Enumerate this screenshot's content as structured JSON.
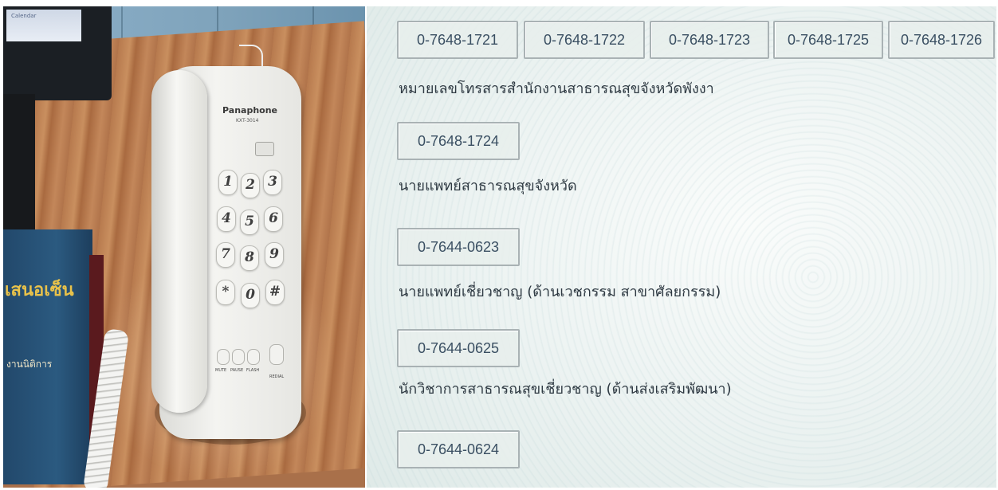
{
  "photo": {
    "brand": "Panaphone",
    "model": "KXT-3014",
    "keys": [
      "1",
      "2",
      "3",
      "4",
      "5",
      "6",
      "7",
      "8",
      "9",
      "*",
      "0",
      "#"
    ],
    "function_keys": [
      "MUTE",
      "PAUSE",
      "FLASH",
      "REDIAL"
    ],
    "book_title": "เสนอเซ็น",
    "book_subtitle": "งานนิติการ",
    "screen_text": "Calendar"
  },
  "directory": {
    "top_numbers": [
      "0-7648-1721",
      "0-7648-1722",
      "0-7648-1723",
      "0-7648-1725",
      "0-7648-1726"
    ],
    "entries": [
      {
        "label": "หมายเลขโทรสารสำนักงานสาธารณสุขจังหวัดพังงา",
        "number": "0-7648-1724"
      },
      {
        "label": "นายแพทย์สาธารณสุขจังหวัด",
        "number": "0-7644-0623"
      },
      {
        "label": "นายแพทย์เชี่ยวชาญ (ด้านเวชกรรม สาขาศัลยกรรม)",
        "number": "0-7644-0625"
      },
      {
        "label": "นักวิชาการสาธารณสุขเชี่ยวชาญ (ด้านส่งเสริมพัฒนา)",
        "number": "0-7644-0624"
      }
    ]
  }
}
